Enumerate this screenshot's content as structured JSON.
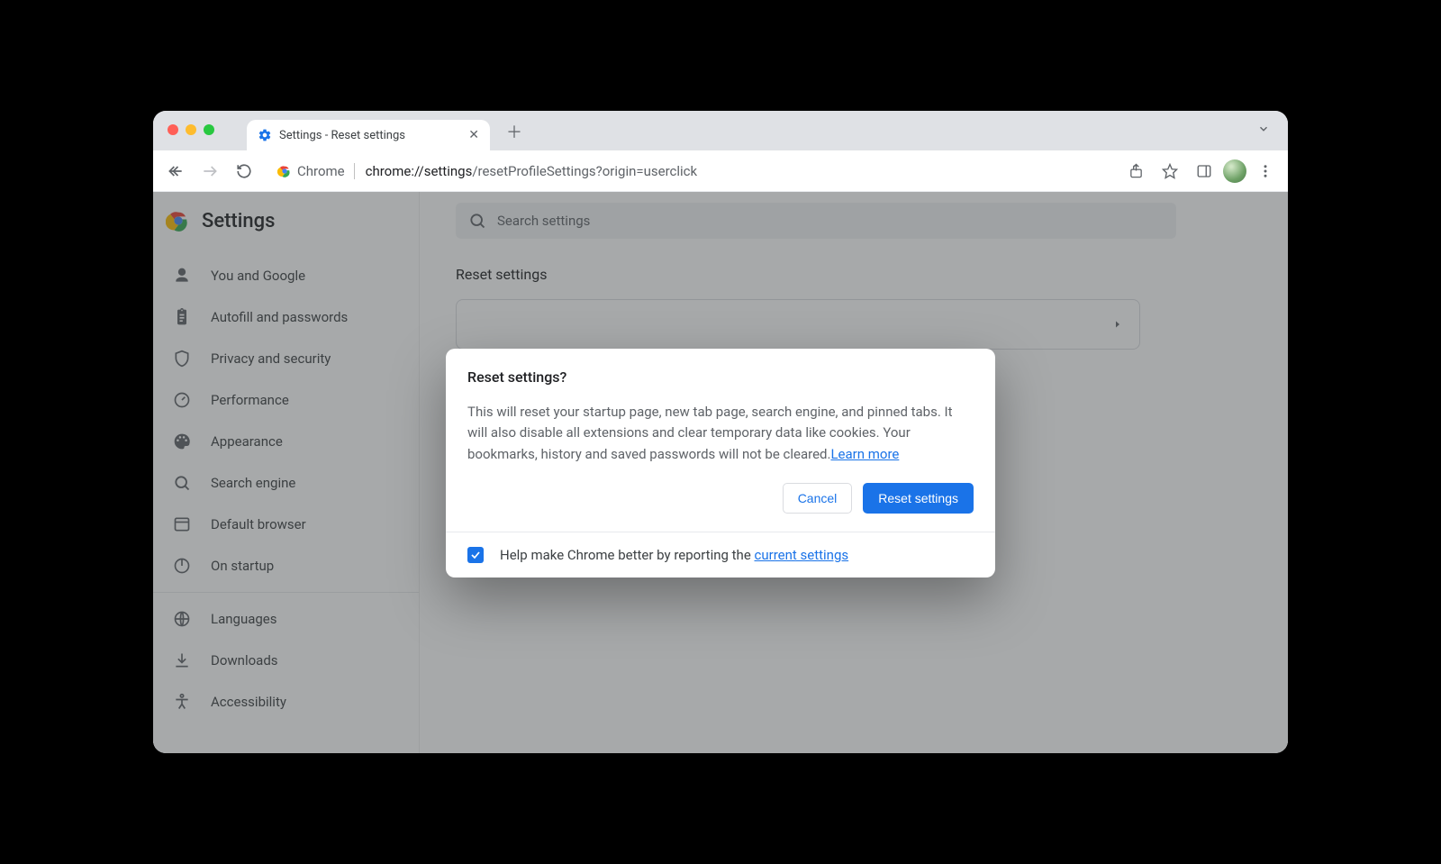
{
  "window": {
    "tab_title": "Settings - Reset settings"
  },
  "omnibox": {
    "label": "Chrome",
    "url_bold": "chrome://settings",
    "url_rest": "/resetProfileSettings?origin=userclick"
  },
  "header": {
    "title": "Settings"
  },
  "search": {
    "placeholder": "Search settings"
  },
  "sidebar": {
    "items": [
      {
        "label": "You and Google"
      },
      {
        "label": "Autofill and passwords"
      },
      {
        "label": "Privacy and security"
      },
      {
        "label": "Performance"
      },
      {
        "label": "Appearance"
      },
      {
        "label": "Search engine"
      },
      {
        "label": "Default browser"
      },
      {
        "label": "On startup"
      }
    ],
    "items2": [
      {
        "label": "Languages"
      },
      {
        "label": "Downloads"
      },
      {
        "label": "Accessibility"
      }
    ]
  },
  "main": {
    "section_title": "Reset settings"
  },
  "modal": {
    "title": "Reset settings?",
    "body": "This will reset your startup page, new tab page, search engine, and pinned tabs. It will also disable all extensions and clear temporary data like cookies. Your bookmarks, history and saved passwords will not be cleared.",
    "learn_more": "Learn more",
    "cancel": "Cancel",
    "confirm": "Reset settings",
    "report_prefix": "Help make Chrome better by reporting the ",
    "report_link": "current settings",
    "checked": true
  }
}
